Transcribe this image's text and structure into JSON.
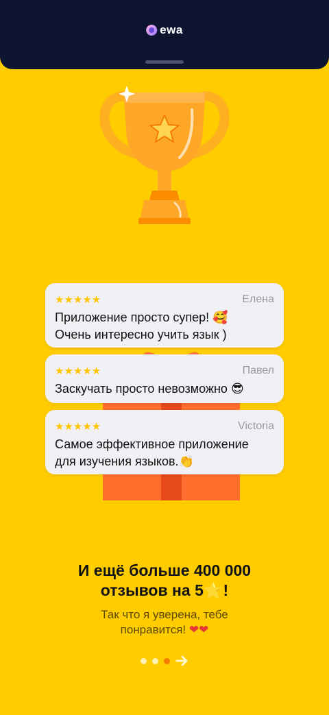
{
  "header": {
    "logo_text": "ewa"
  },
  "reviews": [
    {
      "stars": "★★★★★",
      "name": "Елена",
      "text_line1": "Приложение просто супер! ",
      "emoji1": "🥰",
      "text_line2": "Очень интересно учить язык )"
    },
    {
      "stars": "★★★★★",
      "name": "Павел",
      "text_line1": "Заскучать просто невозможно ",
      "emoji1": "😎"
    },
    {
      "stars": "★★★★★",
      "name": "Victoria",
      "text_line1": "Самое эффективное приложение",
      "text_line2": "для изучения языков.",
      "emoji2": "👏"
    }
  ],
  "headline": {
    "line1": "И ещё больше 400 000",
    "line2_text": "отзывов на 5",
    "line2_emoji": "⭐",
    "line2_end": "!"
  },
  "subtitle": {
    "line1": "Так что я уверена, тебе",
    "line2": "понравится! ",
    "hearts": "❤❤"
  },
  "pager": {
    "total": 3,
    "active_index": 2
  },
  "colors": {
    "background": "#FFCC00",
    "header": "#0D1430",
    "card": "#F0F0F5",
    "star": "#FFC400",
    "active_dot": "#F57C00"
  }
}
